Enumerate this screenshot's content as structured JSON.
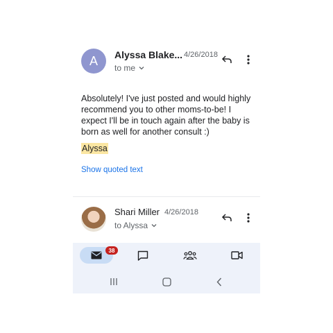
{
  "message1": {
    "avatar_letter": "A",
    "sender": "Alyssa Blake...",
    "date": "4/26/2018",
    "recipient": "to me",
    "body": "Absolutely! I've just posted and would highly recommend you to other moms-to-be! I expect I'll be in touch again after the baby is born as well for another consult :)",
    "signature": "Alyssa",
    "quoted_link": "Show quoted text"
  },
  "message2": {
    "sender": "Shari Miller",
    "date": "4/26/2018",
    "recipient": "to Alyssa"
  },
  "bottom_nav": {
    "mail_badge": "38",
    "items": [
      "mail-icon",
      "chat-icon",
      "spaces-icon",
      "meet-icon"
    ]
  },
  "colors": {
    "avatar": "#8f96cf",
    "link": "#1a73e8",
    "highlight": "#fbe6a2",
    "badge": "#c5221f",
    "nav_bg": "#eef2fa",
    "nav_active": "#c8dcf5"
  }
}
